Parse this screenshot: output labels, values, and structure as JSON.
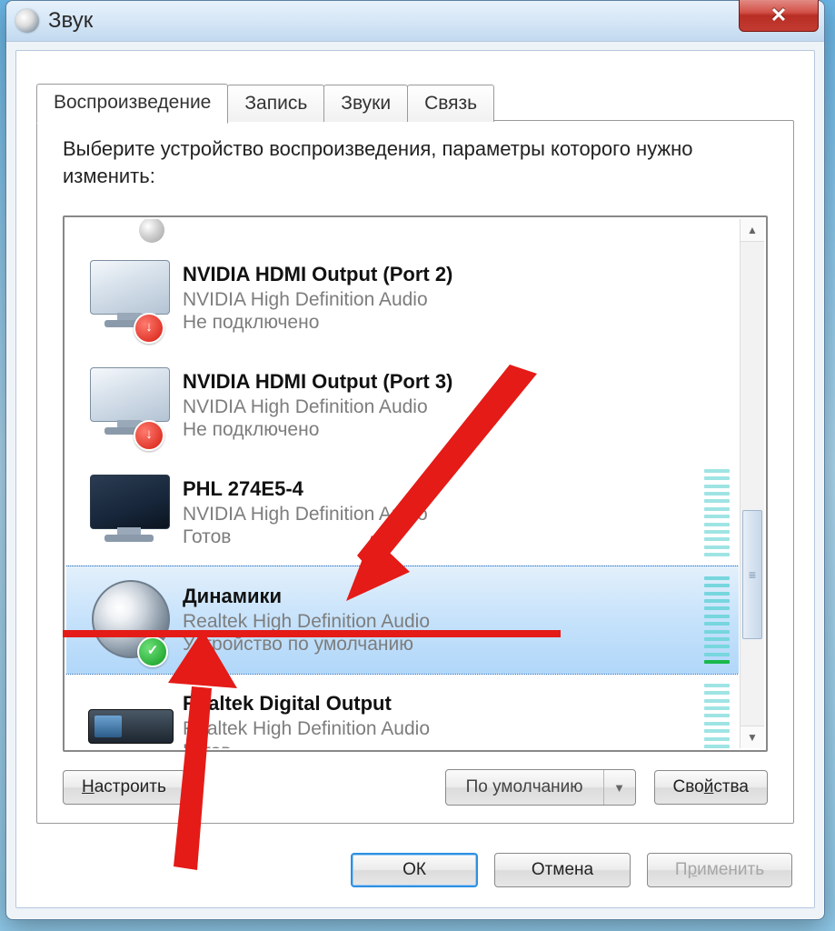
{
  "window": {
    "title": "Звук"
  },
  "tabs": [
    {
      "label": "Воспроизведение",
      "active": true
    },
    {
      "label": "Запись"
    },
    {
      "label": "Звуки"
    },
    {
      "label": "Связь"
    }
  ],
  "instruction": "Выберите устройство воспроизведения, параметры которого нужно изменить:",
  "devices": [
    {
      "name": "NVIDIA HDMI Output (Port 2)",
      "driver": "NVIDIA High Definition Audio",
      "status": "Не подключено",
      "icon": "monitor-off",
      "badge": "red",
      "selected": false,
      "meter": false
    },
    {
      "name": "NVIDIA HDMI Output (Port 3)",
      "driver": "NVIDIA High Definition Audio",
      "status": "Не подключено",
      "icon": "monitor-off",
      "badge": "red",
      "selected": false,
      "meter": false
    },
    {
      "name": "PHL 274E5-4",
      "driver": "NVIDIA High Definition Audio",
      "status": "Готов",
      "icon": "monitor-on",
      "badge": null,
      "selected": false,
      "meter": true,
      "level": 0
    },
    {
      "name": "Динамики",
      "driver": "Realtek High Definition Audio",
      "status": "Устройство по умолчанию",
      "icon": "speaker",
      "badge": "green",
      "selected": true,
      "meter": true,
      "level": 1
    },
    {
      "name": "Realtek Digital Output",
      "driver": "Realtek High Definition Audio",
      "status": "Готов",
      "icon": "receiver",
      "badge": null,
      "selected": false,
      "meter": true,
      "level": 0
    }
  ],
  "buttons": {
    "configure": "Настроить",
    "configure_u": "Н",
    "set_default": "По умолчанию",
    "set_default_u": "ч",
    "properties": "Свойства",
    "properties_u": "й",
    "ok": "ОК",
    "cancel": "Отмена",
    "apply": "Применить",
    "apply_u": "р"
  }
}
